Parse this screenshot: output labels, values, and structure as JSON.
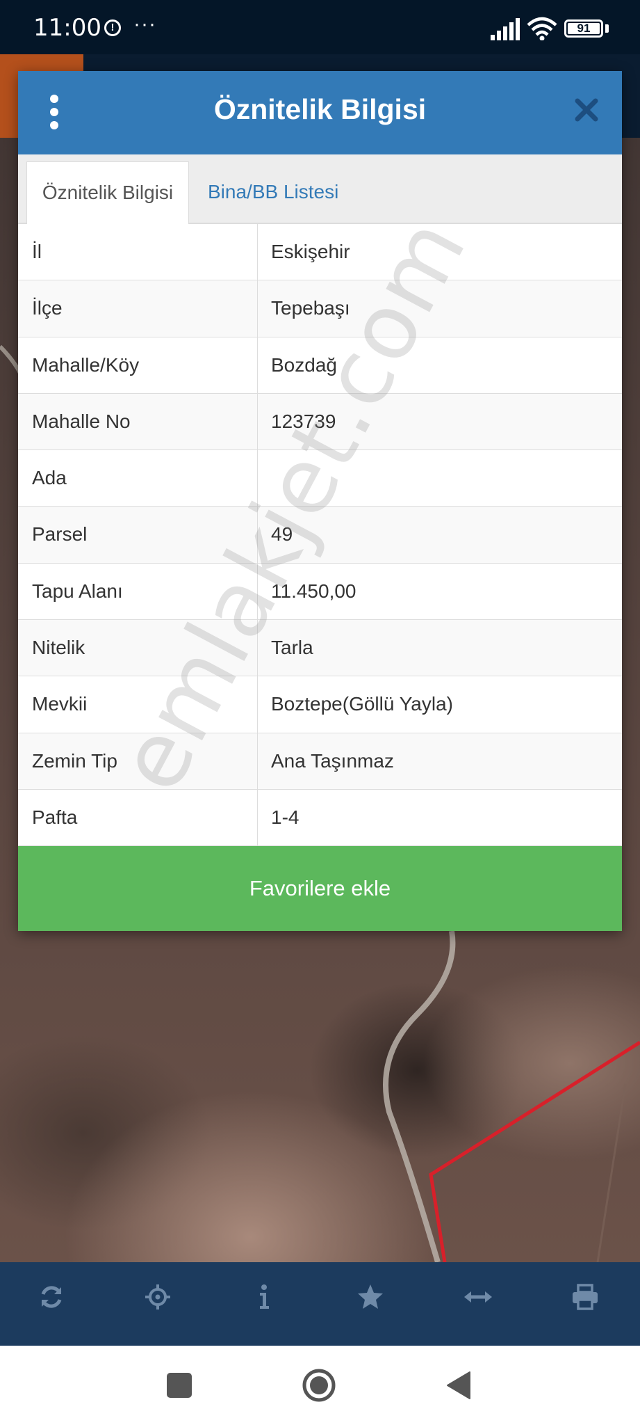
{
  "status_bar": {
    "time": "11:00",
    "alert_glyph": "!",
    "dots": "···",
    "battery": "91"
  },
  "modal": {
    "title": "Öznitelik Bilgisi",
    "tabs": [
      {
        "label": "Öznitelik Bilgisi",
        "active": true
      },
      {
        "label": "Bina/BB Listesi",
        "active": false
      }
    ],
    "rows": [
      {
        "key": "İl",
        "value": "Eskişehir"
      },
      {
        "key": "İlçe",
        "value": "Tepebaşı"
      },
      {
        "key": "Mahalle/Köy",
        "value": "Bozdağ"
      },
      {
        "key": "Mahalle No",
        "value": "123739"
      },
      {
        "key": "Ada",
        "value": ""
      },
      {
        "key": "Parsel",
        "value": "49"
      },
      {
        "key": "Tapu Alanı",
        "value": "11.450,00"
      },
      {
        "key": "Nitelik",
        "value": "Tarla"
      },
      {
        "key": "Mevkii",
        "value": "Boztepe(Göllü Yayla)"
      },
      {
        "key": "Zemin Tip",
        "value": "Ana Taşınmaz"
      },
      {
        "key": "Pafta",
        "value": "1-4"
      }
    ],
    "favorite_button": "Favorilere ekle"
  },
  "watermark": "emlakjet.com",
  "toolbar": {
    "icons": [
      "refresh-icon",
      "crosshair-icon",
      "info-icon",
      "star-icon",
      "measure-icon",
      "print-icon"
    ]
  },
  "colors": {
    "header": "#337ab7",
    "button": "#5cb85c",
    "toolbar": "#1c3b5e",
    "status_bar": "#041628"
  }
}
